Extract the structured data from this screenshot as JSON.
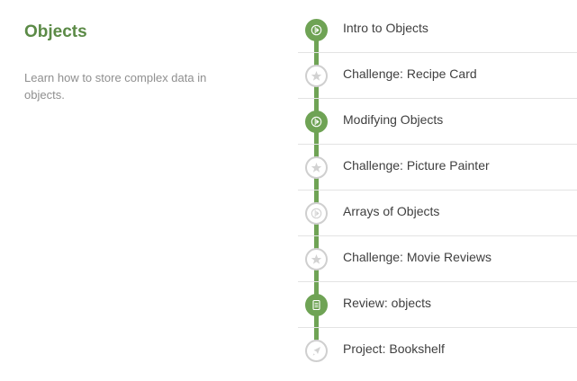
{
  "section": {
    "title": "Objects",
    "description": "Learn how to store complex data in objects."
  },
  "lessons": [
    {
      "label": "Intro to Objects",
      "status": "completed",
      "icon": "talkthrough-icon"
    },
    {
      "label": "Challenge: Recipe Card",
      "status": "not-started",
      "icon": "star-icon"
    },
    {
      "label": "Modifying Objects",
      "status": "completed",
      "icon": "talkthrough-icon"
    },
    {
      "label": "Challenge: Picture Painter",
      "status": "not-started",
      "icon": "star-icon"
    },
    {
      "label": "Arrays of Objects",
      "status": "not-started",
      "icon": "talkthrough-icon"
    },
    {
      "label": "Challenge: Movie Reviews",
      "status": "not-started",
      "icon": "star-icon"
    },
    {
      "label": "Review: objects",
      "status": "completed",
      "icon": "document-icon"
    },
    {
      "label": "Project: Bookshelf",
      "status": "not-started",
      "icon": "rocket-icon"
    }
  ],
  "colors": {
    "accent": "#6fa355",
    "title": "#5b8a46",
    "inactive": "#cfcfcf",
    "description": "#8f8f8f"
  }
}
